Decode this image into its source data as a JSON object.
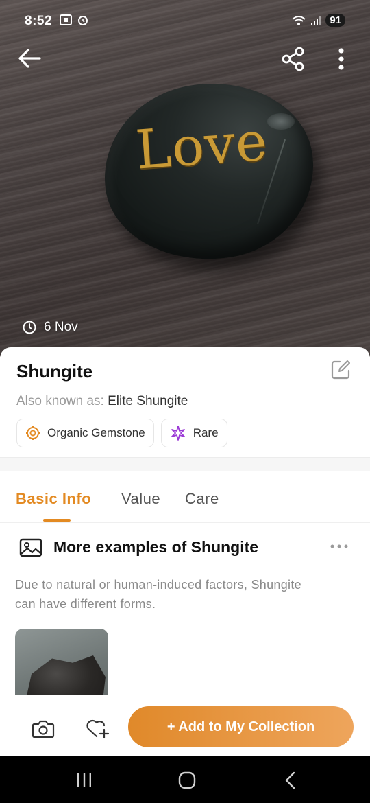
{
  "status_bar": {
    "time": "8:52",
    "battery": "91",
    "left_icons": [
      "screenshot-icon",
      "alarm-icon"
    ],
    "right_icons": [
      "wifi-icon",
      "signal-icon",
      "battery-icon"
    ]
  },
  "hero": {
    "stone_engraving": "Love",
    "date": "6 Nov"
  },
  "plant": {
    "name": "Shungite",
    "aka_label": "Also known as:",
    "aka_value": "Elite Shungite",
    "chips": [
      {
        "label": "Organic Gemstone",
        "icon": "gemstone-icon",
        "icon_color": "#e38a22"
      },
      {
        "label": "Rare",
        "icon": "rare-sparkle-icon",
        "icon_color": "#9b3bd6"
      }
    ]
  },
  "tabs": [
    {
      "label": "Basic Info",
      "active": true
    },
    {
      "label": "Value",
      "active": false
    },
    {
      "label": "Care",
      "active": false
    }
  ],
  "examples": {
    "title": "More examples of Shungite",
    "description": "Due to natural or human-induced factors, Shungite can have different forms."
  },
  "actions": {
    "add_label": "+ Add to My Collection"
  },
  "colors": {
    "accent": "#e38a22",
    "accent_light": "#eea55c"
  }
}
